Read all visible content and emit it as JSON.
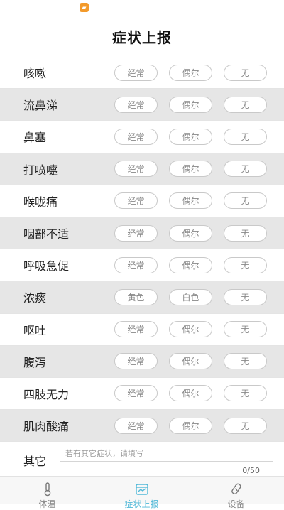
{
  "header": {
    "title": "症状上报"
  },
  "symptoms": [
    {
      "label": "咳嗽",
      "options": [
        "经常",
        "偶尔",
        "无"
      ]
    },
    {
      "label": "流鼻涕",
      "options": [
        "经常",
        "偶尔",
        "无"
      ]
    },
    {
      "label": "鼻塞",
      "options": [
        "经常",
        "偶尔",
        "无"
      ]
    },
    {
      "label": "打喷嚏",
      "options": [
        "经常",
        "偶尔",
        "无"
      ]
    },
    {
      "label": "喉咙痛",
      "options": [
        "经常",
        "偶尔",
        "无"
      ]
    },
    {
      "label": "咽部不适",
      "options": [
        "经常",
        "偶尔",
        "无"
      ]
    },
    {
      "label": "呼吸急促",
      "options": [
        "经常",
        "偶尔",
        "无"
      ]
    },
    {
      "label": "浓痰",
      "options": [
        "黄色",
        "白色",
        "无"
      ]
    },
    {
      "label": "呕吐",
      "options": [
        "经常",
        "偶尔",
        "无"
      ]
    },
    {
      "label": "腹泻",
      "options": [
        "经常",
        "偶尔",
        "无"
      ]
    },
    {
      "label": "四肢无力",
      "options": [
        "经常",
        "偶尔",
        "无"
      ]
    },
    {
      "label": "肌肉酸痛",
      "options": [
        "经常",
        "偶尔",
        "无"
      ]
    }
  ],
  "other": {
    "label": "其它",
    "placeholder": "若有其它症状，请填写",
    "value": "",
    "char_count": "0/50"
  },
  "tabbar": {
    "tabs": [
      {
        "label": "体温",
        "icon": "thermometer-icon"
      },
      {
        "label": "症状上报",
        "icon": "report-icon"
      },
      {
        "label": "设备",
        "icon": "device-icon"
      }
    ],
    "active_index": 1
  },
  "colors": {
    "accent": "#52b9d8",
    "alt_row": "#e6e6e6",
    "status_icon": "#f39a2b"
  }
}
